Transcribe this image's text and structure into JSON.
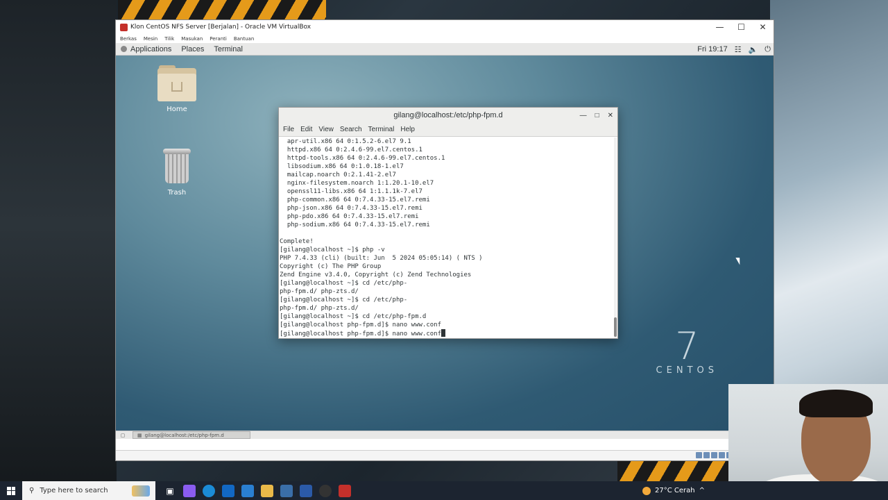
{
  "vbox": {
    "title": "Klon CentOS NFS Server [Berjalan] - Oracle VM VirtualBox",
    "menu": [
      "Berkas",
      "Mesin",
      "Tilik",
      "Masukan",
      "Peranti",
      "Bantuan"
    ],
    "controls": {
      "minimize": "—",
      "maximize": "☐",
      "close": "✕"
    }
  },
  "gnome": {
    "menu": [
      "Applications",
      "Places",
      "Terminal"
    ],
    "clock": "Fri 19:17",
    "tray_icons": [
      "network-icon",
      "volume-icon",
      "power-icon"
    ]
  },
  "desktop": {
    "icons": [
      {
        "label": "Home",
        "icon": "home-folder-icon"
      },
      {
        "label": "Trash",
        "icon": "trash-icon"
      }
    ],
    "branding": {
      "number": "7",
      "word": "CENTOS"
    }
  },
  "terminal": {
    "title": "gilang@localhost:/etc/php-fpm.d",
    "menu": [
      "File",
      "Edit",
      "View",
      "Search",
      "Terminal",
      "Help"
    ],
    "lines": [
      "  apr-util.x86 64 0:1.5.2-6.el7 9.1",
      "  httpd.x86 64 0:2.4.6-99.el7.centos.1",
      "  httpd-tools.x86 64 0:2.4.6-99.el7.centos.1",
      "  libsodium.x86 64 0:1.0.18-1.el7",
      "  mailcap.noarch 0:2.1.41-2.el7",
      "  nginx-filesystem.noarch 1:1.20.1-10.el7",
      "  openssl11-libs.x86 64 1:1.1.1k-7.el7",
      "  php-common.x86 64 0:7.4.33-15.el7.remi",
      "  php-json.x86 64 0:7.4.33-15.el7.remi",
      "  php-pdo.x86 64 0:7.4.33-15.el7.remi",
      "  php-sodium.x86 64 0:7.4.33-15.el7.remi",
      "",
      "Complete!",
      "[gilang@localhost ~]$ php -v",
      "PHP 7.4.33 (cli) (built: Jun  5 2024 05:05:14) ( NTS )",
      "Copyright (c) The PHP Group",
      "Zend Engine v3.4.0, Copyright (c) Zend Technologies",
      "[gilang@localhost ~]$ cd /etc/php-",
      "php-fpm.d/ php-zts.d/",
      "[gilang@localhost ~]$ cd /etc/php-",
      "php-fpm.d/ php-zts.d/",
      "[gilang@localhost ~]$ cd /etc/php-fpm.d",
      "[gilang@localhost php-fpm.d]$ nano www.conf"
    ],
    "prompt_line": "[gilang@localhost php-fpm.d]$ nano www.conf"
  },
  "bottom_panel": {
    "task_label": "gilang@localhost:/etc/php-fpm.d"
  },
  "taskbar": {
    "search_placeholder": "Type here to search",
    "weather": "27°C  Cerah"
  }
}
